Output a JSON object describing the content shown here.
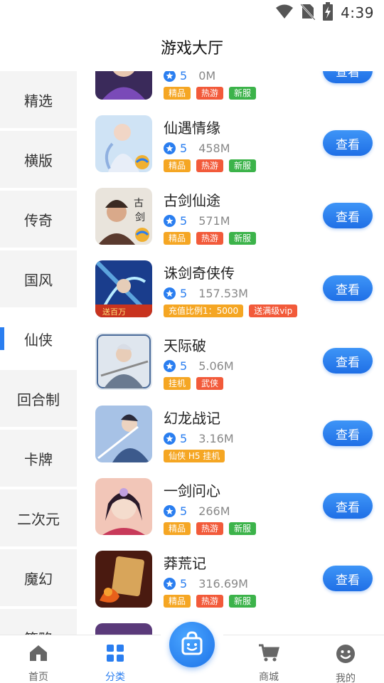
{
  "status_bar": {
    "time": "4:39"
  },
  "header": {
    "title": "游戏大厅"
  },
  "sidebar": {
    "items": [
      {
        "label": "精选"
      },
      {
        "label": "横版"
      },
      {
        "label": "传奇"
      },
      {
        "label": "国风"
      },
      {
        "label": "仙侠"
      },
      {
        "label": "回合制"
      },
      {
        "label": "卡牌"
      },
      {
        "label": "二次元"
      },
      {
        "label": "魔幻"
      },
      {
        "label": "策略"
      }
    ],
    "active": "仙侠"
  },
  "games": [
    {
      "name": "",
      "rating": "5",
      "size": "0M",
      "tags": [
        "精品",
        "热游",
        "新服"
      ]
    },
    {
      "name": "仙遇情缘",
      "rating": "5",
      "size": "458M",
      "tags": [
        "精品",
        "热游",
        "新服"
      ]
    },
    {
      "name": "古剑仙途",
      "rating": "5",
      "size": "571M",
      "tags": [
        "精品",
        "热游",
        "新服"
      ]
    },
    {
      "name": "诛剑奇侠传",
      "rating": "5",
      "size": "157.53M",
      "tags": [
        "充值比例1：5000",
        "送满级vip"
      ]
    },
    {
      "name": "天际破",
      "rating": "5",
      "size": "5.06M",
      "tags": [
        "挂机",
        "武侠"
      ]
    },
    {
      "name": "幻龙战记",
      "rating": "5",
      "size": "3.16M",
      "tags": [
        "仙侠 H5 挂机"
      ]
    },
    {
      "name": "一剑问心",
      "rating": "5",
      "size": "266M",
      "tags": [
        "精品",
        "热游",
        "新服"
      ]
    },
    {
      "name": "莽荒记",
      "rating": "5",
      "size": "316.69M",
      "tags": [
        "精品",
        "热游",
        "新服"
      ]
    }
  ],
  "view_button_label": "查看",
  "colors": {
    "accent": "#2a7ef0",
    "tag_orange": "#f5a623",
    "tag_red": "#f25a3a",
    "tag_green": "#3cb34a"
  },
  "bottom_nav": {
    "items": [
      {
        "label": "首页",
        "icon": "home-icon"
      },
      {
        "label": "分类",
        "icon": "category-icon"
      },
      {
        "label": "商城",
        "icon": "cart-icon"
      },
      {
        "label": "我的",
        "icon": "smile-icon"
      }
    ],
    "center_icon": "shopping-bag-icon",
    "active": "分类"
  }
}
